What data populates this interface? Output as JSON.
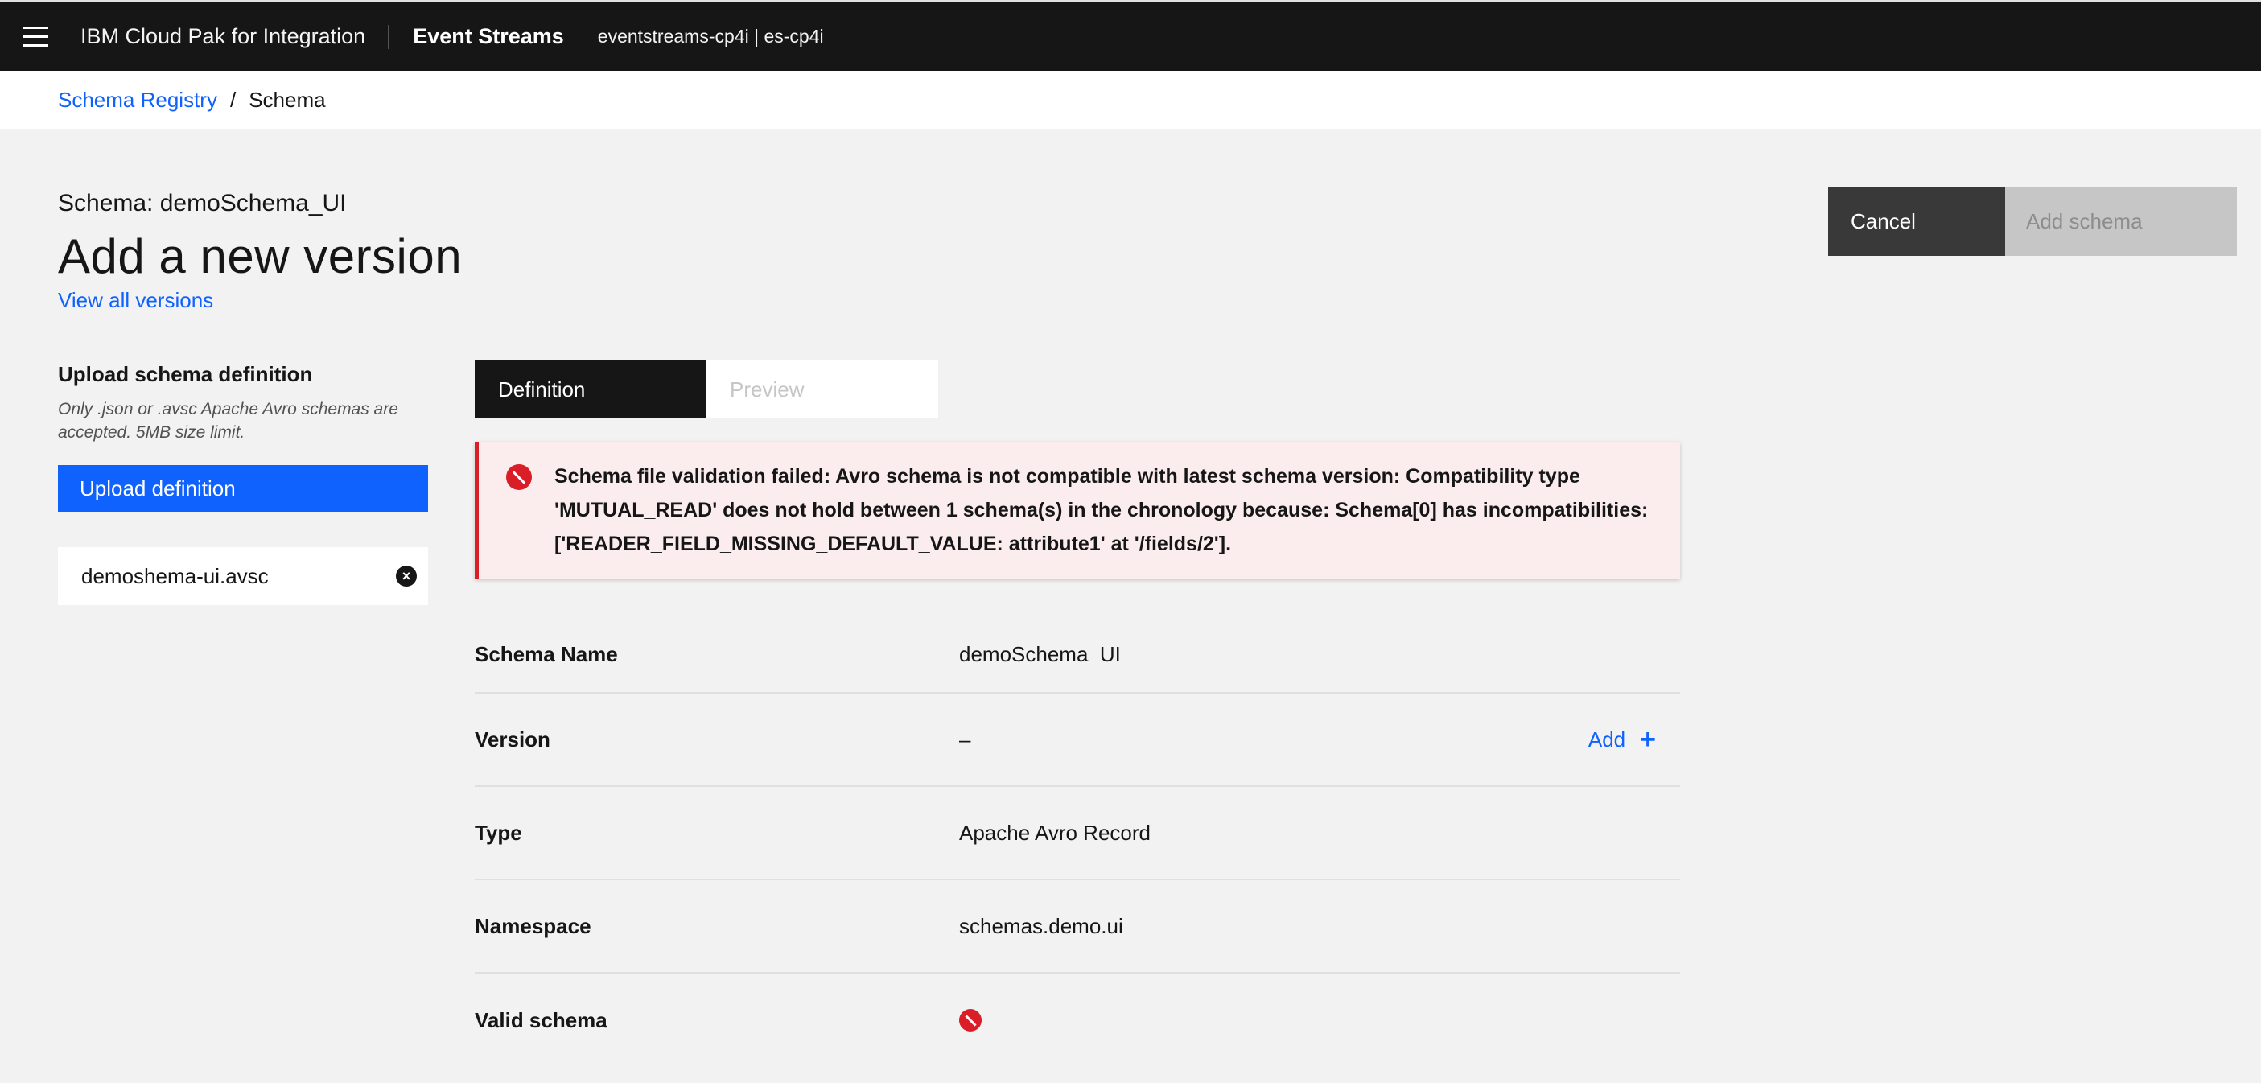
{
  "header": {
    "brand": "IBM Cloud Pak for Integration",
    "product": "Event Streams",
    "instance": "eventstreams-cp4i | es-cp4i"
  },
  "breadcrumb": {
    "parent": "Schema Registry",
    "separator": "/",
    "current": "Schema"
  },
  "page": {
    "schema_label": "Schema: demoSchema_UI",
    "title": "Add a new version",
    "view_versions": "View all versions"
  },
  "actions": {
    "cancel": "Cancel",
    "add_schema": "Add schema"
  },
  "upload": {
    "title": "Upload schema definition",
    "help": "Only .json or .avsc Apache Avro schemas are accepted. 5MB size limit.",
    "button": "Upload definition",
    "file_name": "demoshema-ui.avsc"
  },
  "tabs": [
    {
      "label": "Definition",
      "active": true
    },
    {
      "label": "Preview",
      "active": false
    }
  ],
  "notification": {
    "kind": "error",
    "message": "Schema file validation failed: Avro schema is not compatible with latest schema version: Compatibility type 'MUTUAL_READ' does not hold between 1 schema(s) in the chronology because: Schema[0] has incompatibilities: ['READER_FIELD_MISSING_DEFAULT_VALUE: attribute1' at '/fields/2']."
  },
  "details": {
    "schema_name": {
      "label": "Schema Name",
      "value": "demoSchema  UI"
    },
    "version": {
      "label": "Version",
      "value": "–",
      "add_label": "Add"
    },
    "type": {
      "label": "Type",
      "value": "Apache Avro Record"
    },
    "namespace": {
      "label": "Namespace",
      "value": "schemas.demo.ui"
    },
    "valid_schema": {
      "label": "Valid schema",
      "icon": "invalid-icon"
    }
  },
  "colors": {
    "header_bg": "#161616",
    "link": "#0f62fe",
    "error": "#da1e28",
    "error_bg": "#fbeded"
  }
}
